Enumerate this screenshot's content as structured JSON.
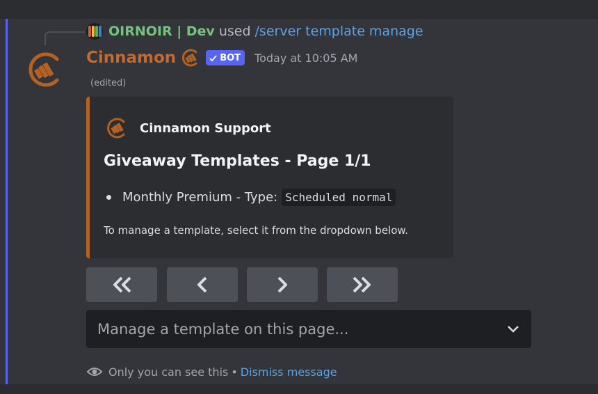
{
  "command": {
    "user": "OIRNOIR | Dev",
    "used": "used",
    "name": "/server template manage"
  },
  "message": {
    "bot_name": "Cinnamon",
    "bot_tag": "BOT",
    "timestamp": "Today at 10:05 AM",
    "edited": "(edited)"
  },
  "embed": {
    "accent_color": "#b36224",
    "author": "Cinnamon Support",
    "title": "Giveaway Templates - Page 1/1",
    "items": [
      {
        "text": "Monthly Premium - Type:",
        "code": "Scheduled normal"
      }
    ],
    "description": "To manage a template, select it from the dropdown below."
  },
  "buttons": [
    {
      "icon": "double-chevron-left-icon",
      "glyph": "first"
    },
    {
      "icon": "chevron-left-icon",
      "glyph": "previous"
    },
    {
      "icon": "chevron-right-icon",
      "glyph": "next"
    },
    {
      "icon": "double-chevron-right-icon",
      "glyph": "last"
    }
  ],
  "select": {
    "placeholder": "Manage a template on this page..."
  },
  "footer": {
    "visibility": "Only you can see this",
    "separator": "•",
    "dismiss": "Dismiss message"
  },
  "colors": {
    "bot_name": "#c26a30",
    "command_user": "#74c27e",
    "link": "#5aa3e6",
    "blurple": "#5865f2"
  }
}
